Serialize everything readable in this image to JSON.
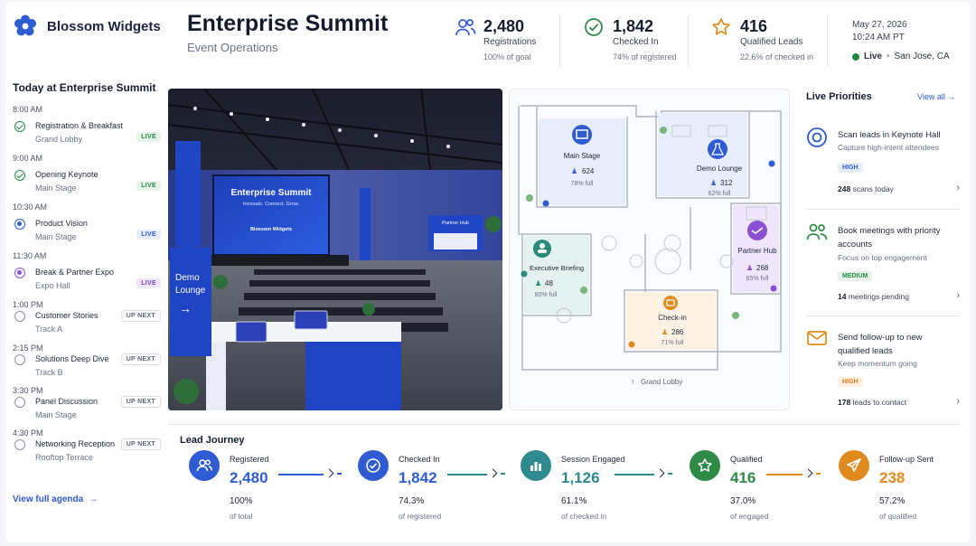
{
  "brand": {
    "name": "Blossom Widgets"
  },
  "header": {
    "title": "Enterprise Summit",
    "subtitle": "Event Operations"
  },
  "stats": [
    {
      "value": "2,480",
      "label": "Registrations",
      "sub": "100% of goal",
      "icon": "users-icon",
      "color": "#2f5bd3"
    },
    {
      "value": "1,842",
      "label": "Checked In",
      "sub": "74% of registered",
      "icon": "check-circle-icon",
      "color": "#2e8b46"
    },
    {
      "value": "416",
      "label": "Qualified Leads",
      "sub": "22.6% of checked in",
      "icon": "star-icon",
      "color": "#e08a1e"
    }
  ],
  "datetime": {
    "date": "May 27, 2026",
    "time": "10:24 AM PT"
  },
  "status": {
    "state": "Live",
    "location": "San Jose, CA"
  },
  "agenda": {
    "title": "Today at Enterprise Summit",
    "items": [
      {
        "time": "8:00 AM",
        "name": "Registration & Breakfast",
        "room": "Grand Lobby",
        "badge": "LIVE",
        "state": "done"
      },
      {
        "time": "9:00 AM",
        "name": "Opening Keynote",
        "room": "Main Stage",
        "badge": "LIVE",
        "state": "done"
      },
      {
        "time": "10:30 AM",
        "name": "Product Vision",
        "room": "Main Stage",
        "badge": "LIVE",
        "state": "now"
      },
      {
        "time": "11:30 AM",
        "name": "Break & Partner Expo",
        "room": "Expo Hall",
        "badge": "LIVE",
        "state": "expo"
      },
      {
        "time": "1:00 PM",
        "name": "Customer Stories",
        "room": "Track A",
        "badge": "UP NEXT",
        "state": "next"
      },
      {
        "time": "2:15 PM",
        "name": "Solutions Deep Dive",
        "room": "Track B",
        "badge": "UP NEXT",
        "state": "next"
      },
      {
        "time": "3:30 PM",
        "name": "Panel Discussion",
        "room": "Main Stage",
        "badge": "UP NEXT",
        "state": "next"
      },
      {
        "time": "4:30 PM",
        "name": "Networking Reception",
        "room": "Rooftop Terrace",
        "badge": "UP NEXT",
        "state": "next"
      }
    ],
    "link": "View full agenda"
  },
  "photo": {
    "screen_title": "Enterprise Summit",
    "screen_tagline": "Innovate. Connect. Grow.",
    "screen_brand": "Blossom Widgets",
    "booth_sign": "Partner Hub",
    "lounge_sign_1": "Demo",
    "lounge_sign_2": "Lounge"
  },
  "map": {
    "rooms": [
      {
        "name": "Main Stage",
        "count": "624",
        "pct": "78% full",
        "icon": "stage-icon"
      },
      {
        "name": "Demo Lounge",
        "count": "312",
        "pct": "62% full",
        "icon": "flask-icon"
      },
      {
        "name": "Partner Hub",
        "count": "268",
        "pct": "65% full",
        "icon": "handshake-icon"
      },
      {
        "name": "Executive Briefing",
        "count": "48",
        "pct": "80% full",
        "icon": "people-icon"
      },
      {
        "name": "Check-in",
        "count": "286",
        "pct": "71% full",
        "icon": "checkin-icon"
      }
    ],
    "entrance": "Grand Lobby",
    "colors": {
      "main": "#2f5bd3",
      "demo": "#2f5bd3",
      "partner": "#8a4fd3",
      "exec": "#2a8a7a",
      "checkin": "#e08a1e"
    }
  },
  "priorities": {
    "title": "Live Priorities",
    "view_all": "View all",
    "items": [
      {
        "title": "Scan leads in Keynote Hall",
        "desc": "Capture high-intent attendees",
        "badge": "HIGH",
        "count": "248",
        "count_text": "scans today",
        "icon": "target-icon"
      },
      {
        "title": "Book meetings with priority accounts",
        "desc": "Focus on top engagement",
        "badge": "MEDIUM",
        "count": "14",
        "count_text": "meetings pending",
        "icon": "people-icon"
      },
      {
        "title": "Send follow-up to new qualified leads",
        "desc": "Keep momentum going",
        "badge": "HIGH",
        "count": "178",
        "count_text": "leads to contact",
        "icon": "mail-icon"
      }
    ]
  },
  "journey": {
    "title": "Lead Journey",
    "stages": [
      {
        "name": "Registered",
        "value": "2,480",
        "pct": "100%",
        "of": "of total",
        "color": "#2f5bd3",
        "icon": "users-icon"
      },
      {
        "name": "Checked In",
        "value": "1,842",
        "pct": "74.3%",
        "of": "of registered",
        "color": "#2f5bd3",
        "icon": "check-circle-icon"
      },
      {
        "name": "Session Engaged",
        "value": "1,126",
        "pct": "61.1%",
        "of": "of checked in",
        "color": "#2f8a8f",
        "icon": "bar-chart-icon"
      },
      {
        "name": "Qualified",
        "value": "416",
        "pct": "37.0%",
        "of": "of engaged",
        "color": "#2e8b46",
        "icon": "star-icon"
      },
      {
        "name": "Follow-up Sent",
        "value": "238",
        "pct": "57.2%",
        "of": "of qualified",
        "color": "#e08a1e",
        "icon": "send-icon"
      }
    ]
  }
}
